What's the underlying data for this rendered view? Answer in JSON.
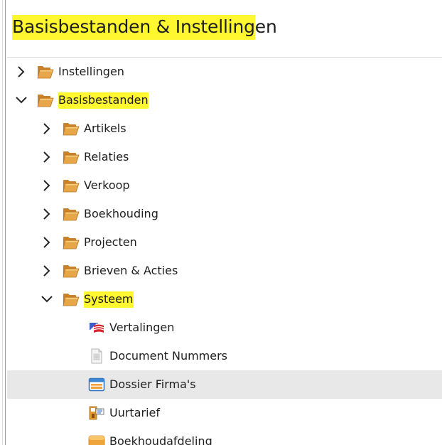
{
  "panel": {
    "title_highlighted": "Basisbestanden & Instelling",
    "title_rest": "en"
  },
  "tree": {
    "items": [
      {
        "label": "Instellingen",
        "highlight": false,
        "icon": "folder-icon",
        "toggle": "chevron-right"
      },
      {
        "label": "Basisbestanden",
        "highlight": true,
        "icon": "folder-icon",
        "toggle": "chevron-down"
      },
      {
        "label": "Artikels",
        "highlight": false,
        "icon": "folder-icon",
        "toggle": "chevron-right"
      },
      {
        "label": "Relaties",
        "highlight": false,
        "icon": "folder-icon",
        "toggle": "chevron-right"
      },
      {
        "label": "Verkoop",
        "highlight": false,
        "icon": "folder-icon",
        "toggle": "chevron-right"
      },
      {
        "label": "Boekhouding",
        "highlight": false,
        "icon": "folder-icon",
        "toggle": "chevron-right"
      },
      {
        "label": "Projecten",
        "highlight": false,
        "icon": "folder-icon",
        "toggle": "chevron-right"
      },
      {
        "label": "Brieven & Acties",
        "highlight": false,
        "icon": "folder-icon",
        "toggle": "chevron-right"
      },
      {
        "label": "Systeem",
        "highlight": true,
        "icon": "folder-icon",
        "toggle": "chevron-down"
      },
      {
        "label": "Vertalingen",
        "highlight": false,
        "icon": "flags-icon",
        "toggle": ""
      },
      {
        "label": "Document Nummers",
        "highlight": false,
        "icon": "document-icon",
        "toggle": ""
      },
      {
        "label": "Dossier Firma's",
        "highlight": false,
        "icon": "company-window-icon",
        "toggle": "",
        "selected": true
      },
      {
        "label": "Uurtarief",
        "highlight": false,
        "icon": "rate-icon",
        "toggle": ""
      },
      {
        "label": "Boekhoudafdeling",
        "highlight": false,
        "icon": "department-icon",
        "toggle": ""
      }
    ]
  },
  "colors": {
    "highlight": "#fff830",
    "selected_row": "#e8e8e8",
    "folder": "#e8a64a"
  }
}
